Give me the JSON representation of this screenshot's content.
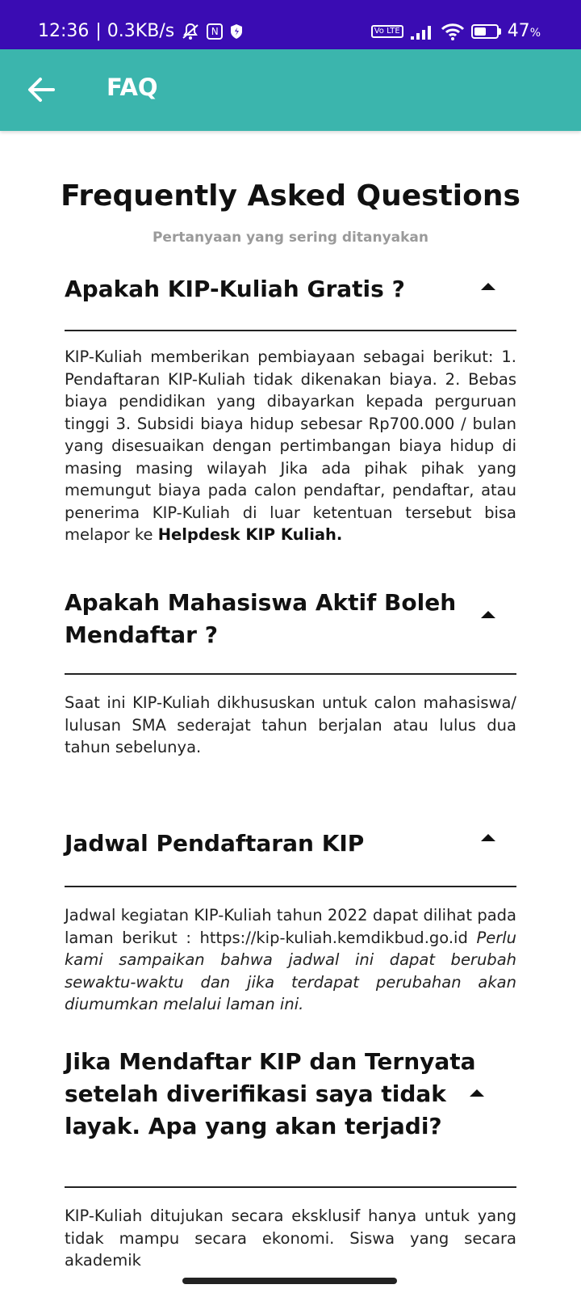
{
  "status_bar": {
    "time": "12:36",
    "speed": "| 0.3KB/s",
    "battery": "47",
    "battery_unit": "%",
    "volte": "Vo LTE",
    "icons": [
      "mute-icon",
      "nfc-icon",
      "shield-icon",
      "signal-icon",
      "wifi-icon",
      "battery-charging-icon"
    ]
  },
  "app_bar": {
    "title": "FAQ",
    "back_icon": "arrow-left-icon",
    "color": "#3bb5ad"
  },
  "page": {
    "title": "Frequently Asked Questions",
    "subtitle": "Pertanyaan yang sering ditanyakan"
  },
  "faqs": [
    {
      "question": "Apakah KIP-Kuliah Gratis ?",
      "answer": "KIP-Kuliah memberikan pembiayaan sebagai berikut: 1. Pendaftaran KIP-Kuliah tidak dikenakan biaya. 2. Bebas biaya pendidikan yang dibayarkan kepada perguruan tinggi 3. Subsidi biaya hidup sebesar Rp700.000 / bulan yang disesuaikan dengan pertimbangan biaya hidup di masing masing wilayah Jika ada pihak pihak yang memungut biaya pada calon pendaftar, pendaftar, atau penerima KIP-Kuliah di luar ketentuan tersebut bisa melapor ke",
      "answer_link": "Helpdesk KIP Kuliah."
    },
    {
      "question": "Apakah Mahasiswa Aktif Boleh Mendaftar ?",
      "answer": "Saat ini KIP-Kuliah dikhususkan untuk calon mahasiswa/ lulusan SMA sederajat tahun berjalan atau lulus dua tahun sebelunya."
    },
    {
      "question": "Jadwal Pendaftaran KIP",
      "answer": "Jadwal kegiatan KIP-Kuliah tahun 2022 dapat dilihat pada laman berikut : https://kip-kuliah.kemdikbud.go.id",
      "answer_italic": "Perlu kami sampaikan bahwa jadwal ini dapat berubah sewaktu-waktu dan jika terdapat perubahan akan diumumkan melalui laman ini."
    },
    {
      "question": "Jika Mendaftar KIP dan Ternyata setelah diverifikasi saya tidak layak. Apa yang akan terjadi?",
      "answer": "KIP-Kuliah ditujukan secara eksklusif hanya untuk yang tidak mampu secara ekonomi. Siswa yang secara akademik"
    }
  ]
}
